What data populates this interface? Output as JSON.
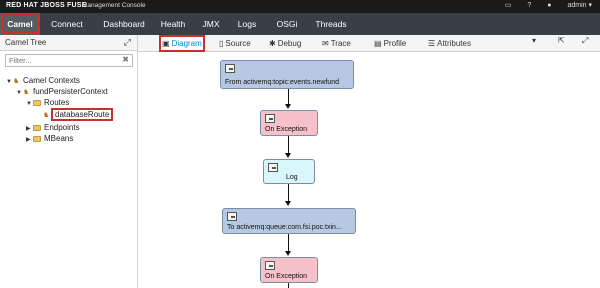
{
  "brand": {
    "name": "RED HAT JBOSS FUSE",
    "subtitle": "Management Console"
  },
  "topbar": {
    "monitor_icon": "monitor-icon",
    "help_icon": "help-icon",
    "user_label": "admin",
    "user_icon": "user-icon"
  },
  "nav": {
    "items": [
      {
        "label": "Camel",
        "active": true
      },
      {
        "label": "Connect"
      },
      {
        "label": "Dashboard"
      },
      {
        "label": "Health"
      },
      {
        "label": "JMX"
      },
      {
        "label": "Logs"
      },
      {
        "label": "OSGi"
      },
      {
        "label": "Threads"
      }
    ]
  },
  "left": {
    "title": "Camel Tree",
    "filter_placeholder": "Filter...",
    "tree": [
      {
        "label": "Camel Contexts",
        "level": 0,
        "expanded": true,
        "icon": "camel-icon"
      },
      {
        "label": "fundPersisterContext",
        "level": 1,
        "expanded": true,
        "icon": "camel-icon"
      },
      {
        "label": "Routes",
        "level": 2,
        "expanded": true,
        "icon": "folder-icon"
      },
      {
        "label": "databaseRoute",
        "level": 3,
        "selected": true,
        "icon": "route-icon"
      },
      {
        "label": "Endpoints",
        "level": 2,
        "expanded": false,
        "icon": "folder-icon"
      },
      {
        "label": "MBeans",
        "level": 2,
        "expanded": false,
        "icon": "folder-icon"
      }
    ]
  },
  "tabs": {
    "items": [
      {
        "label": "Diagram",
        "active": true,
        "icon": "image-icon"
      },
      {
        "label": "Source",
        "icon": "file-icon"
      },
      {
        "label": "Debug",
        "icon": "bug-icon"
      },
      {
        "label": "Trace",
        "icon": "envelope-icon"
      },
      {
        "label": "Profile",
        "icon": "chart-icon"
      },
      {
        "label": "Attributes",
        "icon": "list-icon"
      }
    ]
  },
  "diagram": {
    "nodes": [
      {
        "label": "From activemq:topic:events.newfund",
        "kind": "from"
      },
      {
        "label": "On Exception",
        "kind": "exception"
      },
      {
        "label": "Log",
        "kind": "log"
      },
      {
        "label": "To activemq:queue:com.fsi.poc.txin...",
        "kind": "to"
      },
      {
        "label": "On Exception",
        "kind": "exception"
      }
    ]
  }
}
